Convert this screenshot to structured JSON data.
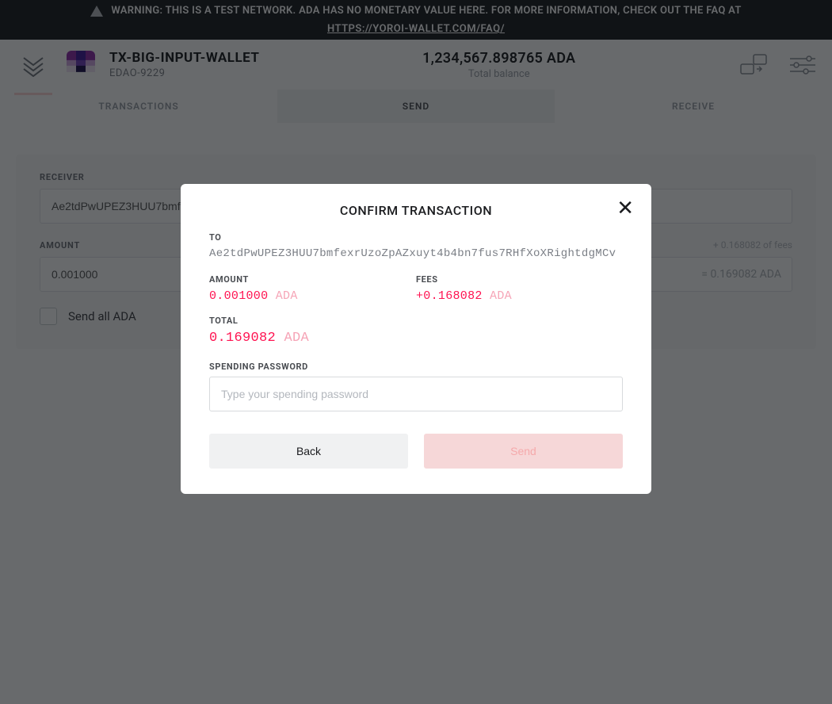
{
  "warning": {
    "text": "WARNING: THIS IS A TEST NETWORK. ADA HAS NO MONETARY VALUE HERE. FOR MORE INFORMATION, CHECK OUT THE FAQ AT",
    "link": "HTTPS://YOROI-WALLET.COM/FAQ/"
  },
  "header": {
    "wallet_name": "TX-BIG-INPUT-WALLET",
    "wallet_sub": "EDAO-9229",
    "balance_value": "1,234,567.898765 ADA",
    "balance_label": "Total balance"
  },
  "tabs": {
    "transactions": "TRANSACTIONS",
    "send": "SEND",
    "receive": "RECEIVE"
  },
  "send_form": {
    "receiver_label": "RECEIVER",
    "receiver_value": "Ae2tdPwUPEZ3HUU7bmfe",
    "amount_label": "AMOUNT",
    "amount_value": "0.001000",
    "fees_hint": "+ 0.168082 of fees",
    "calc": "= 0.169082 ADA",
    "send_all_label": "Send all ADA"
  },
  "modal": {
    "title": "CONFIRM TRANSACTION",
    "to_label": "TO",
    "to_value": "Ae2tdPwUPEZ3HUU7bmfexrUzoZpAZxuyt4b4bn7fus7RHfXoXRightdgMCv",
    "amount_label": "AMOUNT",
    "amount_value": "0.001000",
    "amount_unit": "ADA",
    "fees_label": "FEES",
    "fees_value": "+0.168082",
    "fees_unit": "ADA",
    "total_label": "TOTAL",
    "total_value": "0.169082",
    "total_unit": "ADA",
    "password_label": "SPENDING PASSWORD",
    "password_placeholder": "Type your spending password",
    "back_label": "Back",
    "send_label": "Send"
  }
}
